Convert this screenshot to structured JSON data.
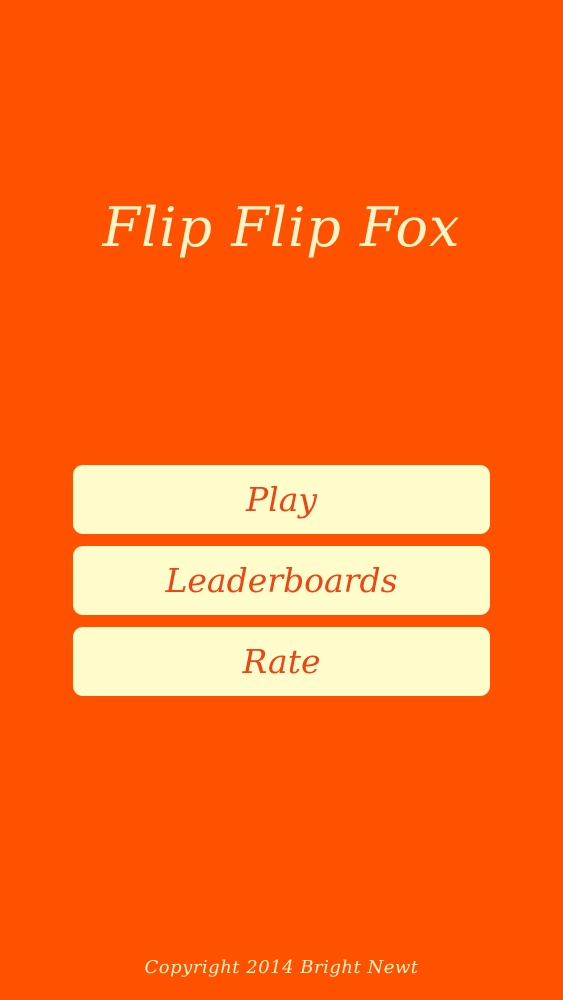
{
  "app": {
    "title": "Flip Flip Fox"
  },
  "menu": {
    "play_label": "Play",
    "leaderboards_label": "Leaderboards",
    "rate_label": "Rate"
  },
  "footer": {
    "copyright": "Copyright 2014 Bright Newt"
  },
  "colors": {
    "background": "#FF5200",
    "button_fill": "#FFFCCC",
    "button_text": "#E94716",
    "title_text": "#FFF4C6"
  }
}
